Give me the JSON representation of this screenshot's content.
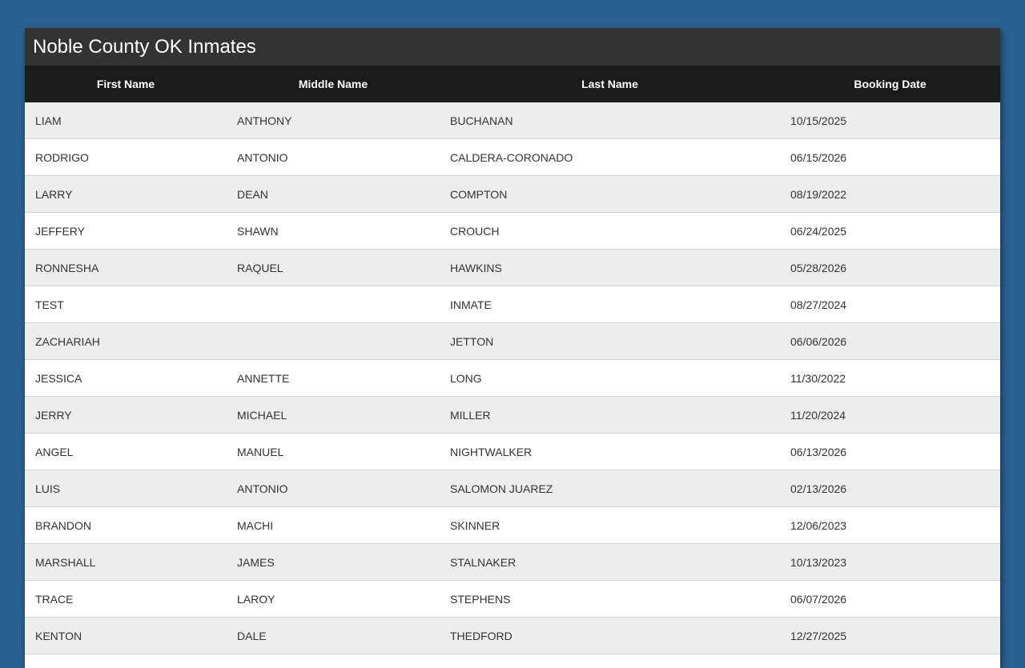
{
  "page": {
    "title": "Noble County OK Inmates"
  },
  "table": {
    "headers": [
      "First Name",
      "Middle Name",
      "Last Name",
      "Booking Date"
    ],
    "rows": [
      [
        "LIAM",
        "ANTHONY",
        "BUCHANAN",
        "10/15/2025"
      ],
      [
        "RODRIGO",
        "ANTONIO",
        "CALDERA-CORONADO",
        "06/15/2026"
      ],
      [
        "LARRY",
        "DEAN",
        "COMPTON",
        "08/19/2022"
      ],
      [
        "JEFFERY",
        "SHAWN",
        "CROUCH",
        "06/24/2025"
      ],
      [
        "RONNESHA",
        "RAQUEL",
        "HAWKINS",
        "05/28/2026"
      ],
      [
        "TEST",
        "",
        "INMATE",
        "08/27/2024"
      ],
      [
        "ZACHARIAH",
        "",
        "JETTON",
        "06/06/2026"
      ],
      [
        "JESSICA",
        "ANNETTE",
        "LONG",
        "11/30/2022"
      ],
      [
        "JERRY",
        "MICHAEL",
        "MILLER",
        "11/20/2024"
      ],
      [
        "ANGEL",
        "MANUEL",
        "NIGHTWALKER",
        "06/13/2026"
      ],
      [
        "LUIS",
        "ANTONIO",
        "SALOMON JUAREZ",
        "02/13/2026"
      ],
      [
        "BRANDON",
        "MACHI",
        "SKINNER",
        "12/06/2023"
      ],
      [
        "MARSHALL",
        "JAMES",
        "STALNAKER",
        "10/13/2023"
      ],
      [
        "TRACE",
        "LAROY",
        "STEPHENS",
        "06/07/2026"
      ],
      [
        "KENTON",
        "DALE",
        "THEDFORD",
        "12/27/2025"
      ]
    ]
  },
  "colors": {
    "background": "#2a6090",
    "title_bar": "#333333",
    "header_row": "#1b1b1b",
    "row_odd": "#ededed",
    "row_even": "#ffffff"
  }
}
